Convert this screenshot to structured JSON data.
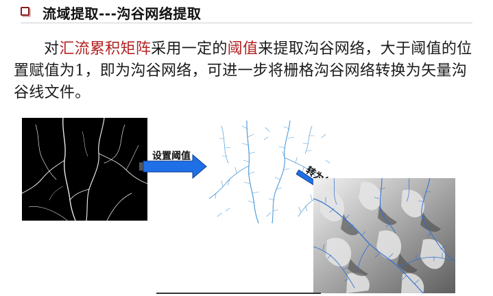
{
  "slide": {
    "title": "流域提取---沟谷网络提取",
    "body": {
      "p1": "对",
      "h1": "汇流累积矩阵",
      "p2": "采用一定的",
      "h2": "阈值",
      "p3": "来提取沟谷网络，大于阈值的位置赋值为1，即为沟谷网络，可进一步将栅格沟谷网络转换为矢量沟谷线文件。"
    },
    "arrow1_label": "设置阈值",
    "arrow2_label": "转为矢量"
  },
  "colors": {
    "highlight": "#b22222",
    "arrow_fill": "#1f6fe6",
    "stream_blue": "#4f9ad6"
  },
  "icons": {
    "title_bullet": "square-bullet-icon",
    "arrow1": "right-arrow-icon",
    "arrow2": "diagonal-arrow-icon"
  }
}
